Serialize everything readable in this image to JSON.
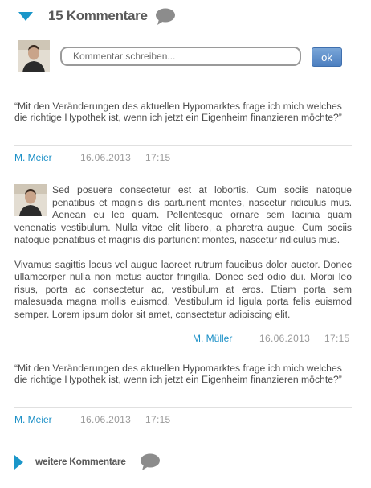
{
  "header": {
    "title": "15 Kommentare",
    "icon": "speech-bubble-icon",
    "accent": "#1a96c9"
  },
  "compose": {
    "placeholder": "Kommentar schreiben...",
    "submit_label": "ok",
    "submit_color": "#4c7fc0"
  },
  "comments": [
    {
      "text": "“Mit den Veränderungen des aktuellen Hypomarktes frage ich mich welches die richtige Hypothek ist, wenn ich jetzt ein Eigenheim finanzieren möchte?”",
      "author": "M. Meier",
      "date": "16.06.2013",
      "time": "17:15"
    },
    {
      "paragraphs": [
        "Sed posuere consectetur est at lobortis. Cum sociis natoque penatibus et magnis dis parturient montes, nascetur ridiculus mus. Aenean eu leo quam. Pellentesque ornare sem lacinia quam venenatis vestibulum. Nulla vitae elit libero, a pharetra augue. Cum sociis natoque penatibus et magnis dis parturient montes, nascetur ridiculus mus.",
        "Vivamus sagittis lacus vel augue laoreet rutrum faucibus dolor auctor. Donec ullamcorper nulla non metus auctor fringilla. Donec sed odio dui. Morbi leo risus, porta ac consectetur ac, vestibulum at eros. Etiam porta sem malesuada magna mollis euismod. Vestibulum id ligula porta felis euismod semper. Lorem ipsum dolor sit amet, consectetur adipiscing elit."
      ],
      "author": "M. Müller",
      "date": "16.06.2013",
      "time": "17:15"
    },
    {
      "text": "“Mit den Veränderungen des aktuellen Hypomarktes frage ich mich welches die richtige Hypothek ist, wenn ich jetzt ein Eigenheim finanzieren möchte?”",
      "author": "M. Meier",
      "date": "16.06.2013",
      "time": "17:15"
    }
  ],
  "footer": {
    "more_label": "weitere Kommentare",
    "icon": "speech-bubble-icon"
  }
}
